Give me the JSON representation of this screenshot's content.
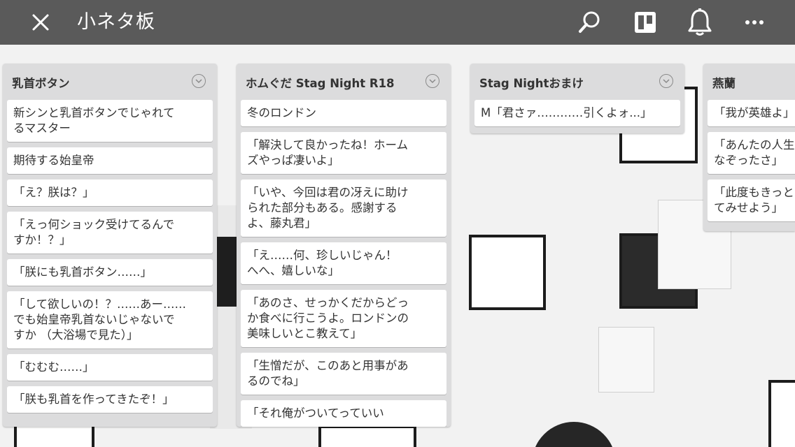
{
  "header": {
    "title": "小ネタ板",
    "icons": [
      "close-icon",
      "search-icon",
      "board-view-icon",
      "bell-icon",
      "more-icon"
    ]
  },
  "lists": [
    {
      "title": "乳首ボタン",
      "cards": [
        "新シンと乳首ボタンでじゃれて\nるマスター",
        "期待する始皇帝",
        "「え？朕は？」",
        "「えっ何ショック受けてるんで\nすか！？」",
        "「朕にも乳首ボタン……」",
        "「して欲しいの！？……あー……\nでも始皇帝乳首ないじゃないで\nすか （大浴場で見た）」",
        "「むむむ……」",
        "「朕も乳首を作ってきたぞ！」"
      ]
    },
    {
      "title": "ホムぐだ Stag Night R18",
      "cards": [
        "冬のロンドン",
        "「解決して良かったね！ホーム\nズやっぱ凄いよ」",
        "「いや、今回は君の冴えに助け\nられた部分もある。感謝する\nよ、藤丸君」",
        "「え……何、珍しいじゃん！\nへへ、嬉しいな」",
        "「あのさ、せっかくだからどっ\nか食べに行こうよ。ロンドンの\n美味しいとこ教えて」",
        "「生憎だが、このあと用事があ\nるのでね」",
        "「それ俺がついてっていい"
      ]
    },
    {
      "title": "Stag Nightおまけ",
      "cards": [
        "M「君さァ…………引くよォ...」"
      ]
    },
    {
      "title": "燕蘭",
      "cards": [
        "「我が英雄よ」",
        "「あんたの人生\nなぞったさ」",
        "「此度もきっと\nてみせよう」"
      ]
    }
  ]
}
